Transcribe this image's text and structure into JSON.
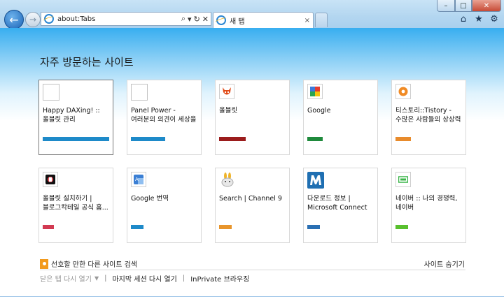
{
  "browser": {
    "address": "about:Tabs",
    "tab_title": "새 탭",
    "tab_close": "×",
    "window_buttons": {
      "minimize": "–",
      "maximize": "□",
      "close": "✕"
    }
  },
  "page": {
    "heading": "자주 방문하는 사이트",
    "tiles": [
      {
        "label": "Happy DAXing! :: 올블릿 관리",
        "bar_color": "#1e8ac9",
        "bar_fill": 1.0,
        "icon": "blank-page-icon"
      },
      {
        "label": "Panel Power - 여러분의 의견이 세상을 움...",
        "bar_color": "#1e8ac9",
        "bar_fill": 0.52,
        "icon": "blank-page-icon"
      },
      {
        "label": "올블릿",
        "bar_color": "#9b1c1c",
        "bar_fill": 0.4,
        "icon": "devil-icon"
      },
      {
        "label": "Google",
        "bar_color": "#1f8a3c",
        "bar_fill": 0.23,
        "icon": "google-icon"
      },
      {
        "label": "티스토리::Tistory - 수많은 사람들의 상상력",
        "bar_color": "#e88b2c",
        "bar_fill": 0.23,
        "icon": "tistory-icon"
      },
      {
        "label": "올블릿 설치하기 | 블로그칵테일 공식 홈...",
        "bar_color": "#d23a52",
        "bar_fill": 0.17,
        "icon": "allblet-install-icon"
      },
      {
        "label": "Google 번역",
        "bar_color": "#1e8ac9",
        "bar_fill": 0.19,
        "icon": "google-translate-icon"
      },
      {
        "label": "Search | Channel 9",
        "bar_color": "#e8952c",
        "bar_fill": 0.19,
        "icon": "bunny-icon"
      },
      {
        "label": "다운로드 정보 | Microsoft Connect",
        "bar_color": "#2a6fb3",
        "bar_fill": 0.19,
        "icon": "m-logo-icon"
      },
      {
        "label": "네이버 :: 나의 경쟁력, 네이버",
        "bar_color": "#59c02e",
        "bar_fill": 0.19,
        "icon": "naver-icon"
      }
    ],
    "discover_link": "선호할 만한 다른 사이트 검색",
    "hide_sites": "사이트 숨기기",
    "footer": {
      "reopen_closed_tabs": "닫은 탭 다시 열기",
      "reopen_last_session": "마지막 세션 다시 열기",
      "inprivate": "InPrivate 브라우징"
    }
  }
}
